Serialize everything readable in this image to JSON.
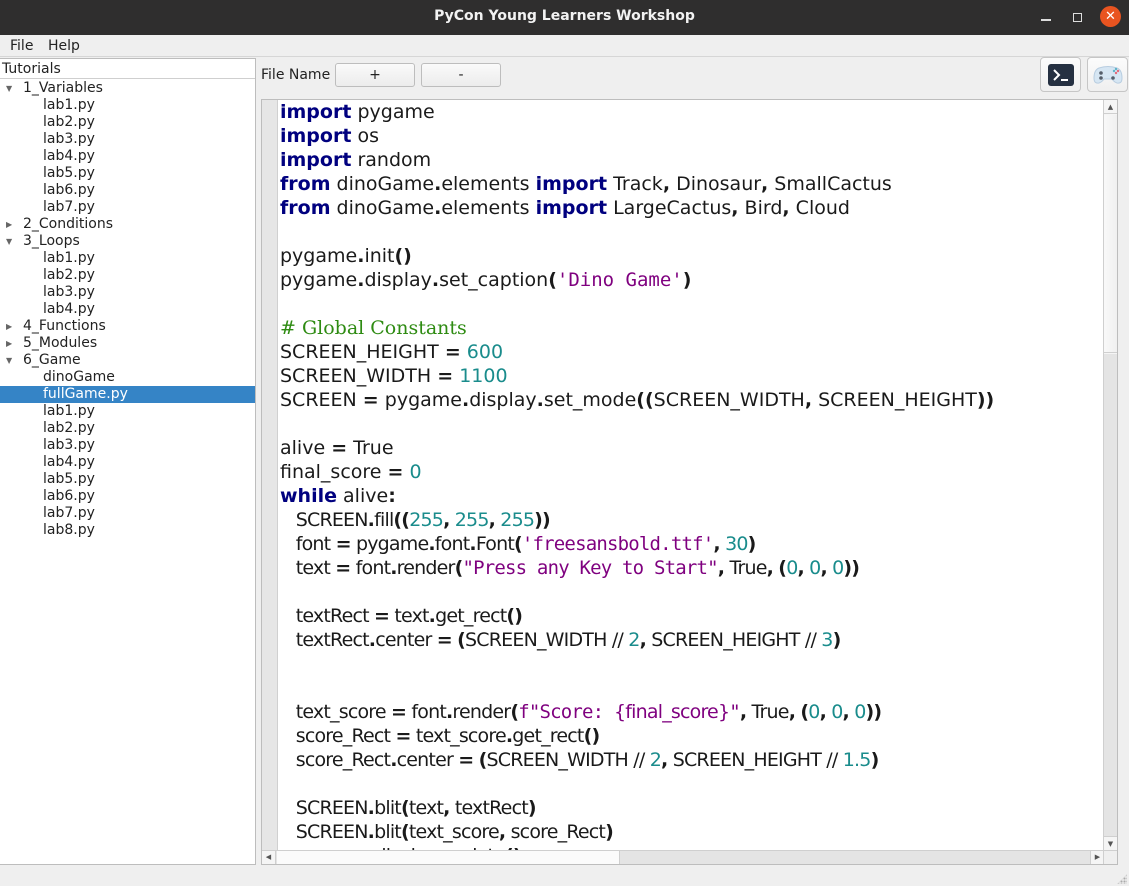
{
  "window": {
    "title": "PyCon Young Learners Workshop",
    "controls": {
      "minimize": "minimize-icon",
      "maximize": "maximize-icon",
      "close": "close-icon"
    }
  },
  "menu": {
    "items": [
      "File",
      "Help"
    ]
  },
  "tree": {
    "header": "Tutorials",
    "rows": [
      {
        "level": 0,
        "label": "1_Variables",
        "expanded": true
      },
      {
        "level": 1,
        "label": "lab1.py"
      },
      {
        "level": 1,
        "label": "lab2.py"
      },
      {
        "level": 1,
        "label": "lab3.py"
      },
      {
        "level": 1,
        "label": "lab4.py"
      },
      {
        "level": 1,
        "label": "lab5.py"
      },
      {
        "level": 1,
        "label": "lab6.py"
      },
      {
        "level": 1,
        "label": "lab7.py"
      },
      {
        "level": 0,
        "label": "2_Conditions",
        "expanded": false
      },
      {
        "level": 0,
        "label": "3_Loops",
        "expanded": true
      },
      {
        "level": 1,
        "label": "lab1.py"
      },
      {
        "level": 1,
        "label": "lab2.py"
      },
      {
        "level": 1,
        "label": "lab3.py"
      },
      {
        "level": 1,
        "label": "lab4.py"
      },
      {
        "level": 0,
        "label": "4_Functions",
        "expanded": false
      },
      {
        "level": 0,
        "label": "5_Modules",
        "expanded": false
      },
      {
        "level": 0,
        "label": "6_Game",
        "expanded": true
      },
      {
        "level": 1,
        "label": "dinoGame"
      },
      {
        "level": 1,
        "label": "fullGame.py",
        "selected": true
      },
      {
        "level": 1,
        "label": "lab1.py"
      },
      {
        "level": 1,
        "label": "lab2.py"
      },
      {
        "level": 1,
        "label": "lab3.py"
      },
      {
        "level": 1,
        "label": "lab4.py"
      },
      {
        "level": 1,
        "label": "lab5.py"
      },
      {
        "level": 1,
        "label": "lab6.py"
      },
      {
        "level": 1,
        "label": "lab7.py"
      },
      {
        "level": 1,
        "label": "lab8.py"
      }
    ]
  },
  "toolbar": {
    "file_name_label": "File Name",
    "add_label": "+",
    "remove_label": "-",
    "terminal_icon": "terminal-icon",
    "game_icon": "gamepad-icon"
  },
  "colors": {
    "keyword": "#00007f",
    "number": "#1a8c8c",
    "string": "#7f007f",
    "comment": "#2e8b12",
    "selection": "#3584c6",
    "close_button": "#e95420"
  },
  "editor": {
    "lines": [
      [
        [
          "kw",
          "import"
        ],
        [
          "t",
          " pygame"
        ]
      ],
      [
        [
          "kw",
          "import"
        ],
        [
          "t",
          " os"
        ]
      ],
      [
        [
          "kw",
          "import"
        ],
        [
          "t",
          " random"
        ]
      ],
      [
        [
          "kw",
          "from"
        ],
        [
          "t",
          " dinoGame"
        ],
        [
          "op",
          "."
        ],
        [
          "t",
          "elements "
        ],
        [
          "kw",
          "import"
        ],
        [
          "t",
          " Track"
        ],
        [
          "op",
          ","
        ],
        [
          "t",
          " Dinosaur"
        ],
        [
          "op",
          ","
        ],
        [
          "t",
          " SmallCactus"
        ]
      ],
      [
        [
          "kw",
          "from"
        ],
        [
          "t",
          " dinoGame"
        ],
        [
          "op",
          "."
        ],
        [
          "t",
          "elements "
        ],
        [
          "kw",
          "import"
        ],
        [
          "t",
          " LargeCactus"
        ],
        [
          "op",
          ","
        ],
        [
          "t",
          " Bird"
        ],
        [
          "op",
          ","
        ],
        [
          "t",
          " Cloud"
        ]
      ],
      [],
      [
        [
          "t",
          "pygame"
        ],
        [
          "op",
          "."
        ],
        [
          "t",
          "init"
        ],
        [
          "op",
          "()"
        ]
      ],
      [
        [
          "t",
          "pygame"
        ],
        [
          "op",
          "."
        ],
        [
          "t",
          "display"
        ],
        [
          "op",
          "."
        ],
        [
          "t",
          "set_caption"
        ],
        [
          "op",
          "("
        ],
        [
          "str",
          "'Dino Game'"
        ],
        [
          "op",
          ")"
        ]
      ],
      [],
      [
        [
          "cmt",
          "# Global Constants"
        ]
      ],
      [
        [
          "t",
          "SCREEN_HEIGHT "
        ],
        [
          "op",
          "="
        ],
        [
          "t",
          " "
        ],
        [
          "num",
          "600"
        ]
      ],
      [
        [
          "t",
          "SCREEN_WIDTH "
        ],
        [
          "op",
          "="
        ],
        [
          "t",
          " "
        ],
        [
          "num",
          "1100"
        ]
      ],
      [
        [
          "t",
          "SCREEN "
        ],
        [
          "op",
          "="
        ],
        [
          "t",
          " pygame"
        ],
        [
          "op",
          "."
        ],
        [
          "t",
          "display"
        ],
        [
          "op",
          "."
        ],
        [
          "t",
          "set_mode"
        ],
        [
          "op",
          "(("
        ],
        [
          "t",
          "SCREEN_WIDTH"
        ],
        [
          "op",
          ","
        ],
        [
          "t",
          " SCREEN_HEIGHT"
        ],
        [
          "op",
          "))"
        ]
      ],
      [],
      [
        [
          "t",
          "alive "
        ],
        [
          "op",
          "="
        ],
        [
          "t",
          " True"
        ]
      ],
      [
        [
          "t",
          "final_score "
        ],
        [
          "op",
          "="
        ],
        [
          "t",
          " "
        ],
        [
          "num",
          "0"
        ]
      ],
      [
        [
          "kw",
          "while"
        ],
        [
          "t",
          " alive"
        ],
        [
          "op",
          ":"
        ]
      ],
      [
        [
          "t",
          "   SCREEN"
        ],
        [
          "op",
          "."
        ],
        [
          "t",
          "fill"
        ],
        [
          "op",
          "(("
        ],
        [
          "num",
          "255"
        ],
        [
          "op",
          ","
        ],
        [
          "t",
          " "
        ],
        [
          "num",
          "255"
        ],
        [
          "op",
          ","
        ],
        [
          "t",
          " "
        ],
        [
          "num",
          "255"
        ],
        [
          "op",
          "))"
        ]
      ],
      [
        [
          "t",
          "   font "
        ],
        [
          "op",
          "="
        ],
        [
          "t",
          " pygame"
        ],
        [
          "op",
          "."
        ],
        [
          "t",
          "font"
        ],
        [
          "op",
          "."
        ],
        [
          "t",
          "Font"
        ],
        [
          "op",
          "("
        ],
        [
          "str",
          "'freesansbold.ttf'"
        ],
        [
          "op",
          ","
        ],
        [
          "t",
          " "
        ],
        [
          "num",
          "30"
        ],
        [
          "op",
          ")"
        ]
      ],
      [
        [
          "t",
          "   text "
        ],
        [
          "op",
          "="
        ],
        [
          "t",
          " font"
        ],
        [
          "op",
          "."
        ],
        [
          "t",
          "render"
        ],
        [
          "op",
          "("
        ],
        [
          "str",
          "\"Press any Key to Start\""
        ],
        [
          "op",
          ","
        ],
        [
          "t",
          " True"
        ],
        [
          "op",
          ","
        ],
        [
          "t",
          " "
        ],
        [
          "op",
          "("
        ],
        [
          "num",
          "0"
        ],
        [
          "op",
          ","
        ],
        [
          "t",
          " "
        ],
        [
          "num",
          "0"
        ],
        [
          "op",
          ","
        ],
        [
          "t",
          " "
        ],
        [
          "num",
          "0"
        ],
        [
          "op",
          "))"
        ]
      ],
      [],
      [
        [
          "t",
          "   textRect "
        ],
        [
          "op",
          "="
        ],
        [
          "t",
          " text"
        ],
        [
          "op",
          "."
        ],
        [
          "t",
          "get_rect"
        ],
        [
          "op",
          "()"
        ]
      ],
      [
        [
          "t",
          "   textRect"
        ],
        [
          "op",
          "."
        ],
        [
          "t",
          "center "
        ],
        [
          "op",
          "="
        ],
        [
          "t",
          " "
        ],
        [
          "op",
          "("
        ],
        [
          "t",
          "SCREEN_WIDTH // "
        ],
        [
          "num",
          "2"
        ],
        [
          "op",
          ","
        ],
        [
          "t",
          " SCREEN_HEIGHT // "
        ],
        [
          "num",
          "3"
        ],
        [
          "op",
          ")"
        ]
      ],
      [],
      [],
      [
        [
          "t",
          "   text_score "
        ],
        [
          "op",
          "="
        ],
        [
          "t",
          " font"
        ],
        [
          "op",
          "."
        ],
        [
          "t",
          "render"
        ],
        [
          "op",
          "("
        ],
        [
          "str",
          "f\"Score: "
        ],
        [
          "str2",
          "{final_score}"
        ],
        [
          "str",
          "\""
        ],
        [
          "op",
          ","
        ],
        [
          "t",
          " True"
        ],
        [
          "op",
          ","
        ],
        [
          "t",
          " "
        ],
        [
          "op",
          "("
        ],
        [
          "num",
          "0"
        ],
        [
          "op",
          ","
        ],
        [
          "t",
          " "
        ],
        [
          "num",
          "0"
        ],
        [
          "op",
          ","
        ],
        [
          "t",
          " "
        ],
        [
          "num",
          "0"
        ],
        [
          "op",
          "))"
        ]
      ],
      [
        [
          "t",
          "   score_Rect "
        ],
        [
          "op",
          "="
        ],
        [
          "t",
          " text_score"
        ],
        [
          "op",
          "."
        ],
        [
          "t",
          "get_rect"
        ],
        [
          "op",
          "()"
        ]
      ],
      [
        [
          "t",
          "   score_Rect"
        ],
        [
          "op",
          "."
        ],
        [
          "t",
          "center "
        ],
        [
          "op",
          "="
        ],
        [
          "t",
          " "
        ],
        [
          "op",
          "("
        ],
        [
          "t",
          "SCREEN_WIDTH // "
        ],
        [
          "num",
          "2"
        ],
        [
          "op",
          ","
        ],
        [
          "t",
          " SCREEN_HEIGHT // "
        ],
        [
          "num",
          "1.5"
        ],
        [
          "op",
          ")"
        ]
      ],
      [],
      [
        [
          "t",
          "   SCREEN"
        ],
        [
          "op",
          "."
        ],
        [
          "t",
          "blit"
        ],
        [
          "op",
          "("
        ],
        [
          "t",
          "text"
        ],
        [
          "op",
          ","
        ],
        [
          "t",
          " textRect"
        ],
        [
          "op",
          ")"
        ]
      ],
      [
        [
          "t",
          "   SCREEN"
        ],
        [
          "op",
          "."
        ],
        [
          "t",
          "blit"
        ],
        [
          "op",
          "("
        ],
        [
          "t",
          "text_score"
        ],
        [
          "op",
          ","
        ],
        [
          "t",
          " score_Rect"
        ],
        [
          "op",
          ")"
        ]
      ],
      [
        [
          "t",
          "   pygame"
        ],
        [
          "op",
          "."
        ],
        [
          "t",
          "display"
        ],
        [
          "op",
          "."
        ],
        [
          "t",
          "update"
        ],
        [
          "op",
          "()"
        ]
      ]
    ]
  }
}
